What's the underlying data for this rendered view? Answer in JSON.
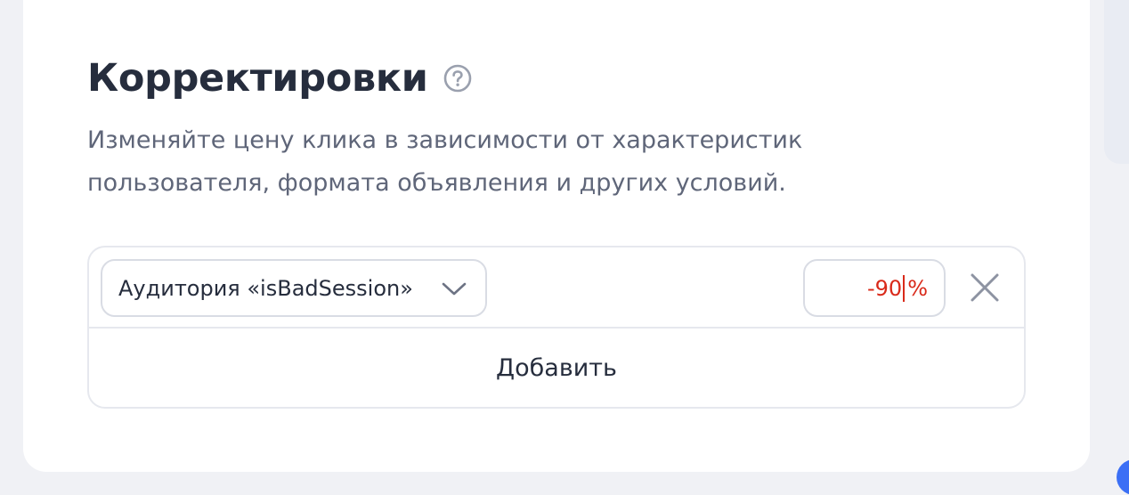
{
  "section": {
    "title": "Корректировки",
    "help_icon": "question-circle-icon",
    "description": "Изменяйте цену клика в зависимости от характеристик пользователя, формата объявления и других условий."
  },
  "adjustment": {
    "audience_select_value": "Аудитория «isBadSession»",
    "select_icon": "chevron-down-icon",
    "percent_value": "-90",
    "percent_unit": "%",
    "remove_icon": "close-icon"
  },
  "add_button_label": "Добавить",
  "colors": {
    "accent_negative": "#d92a1a",
    "text_primary": "#262d3d",
    "text_secondary": "#5f6679",
    "border": "#d9dce4",
    "background": "#f0f1f5"
  }
}
